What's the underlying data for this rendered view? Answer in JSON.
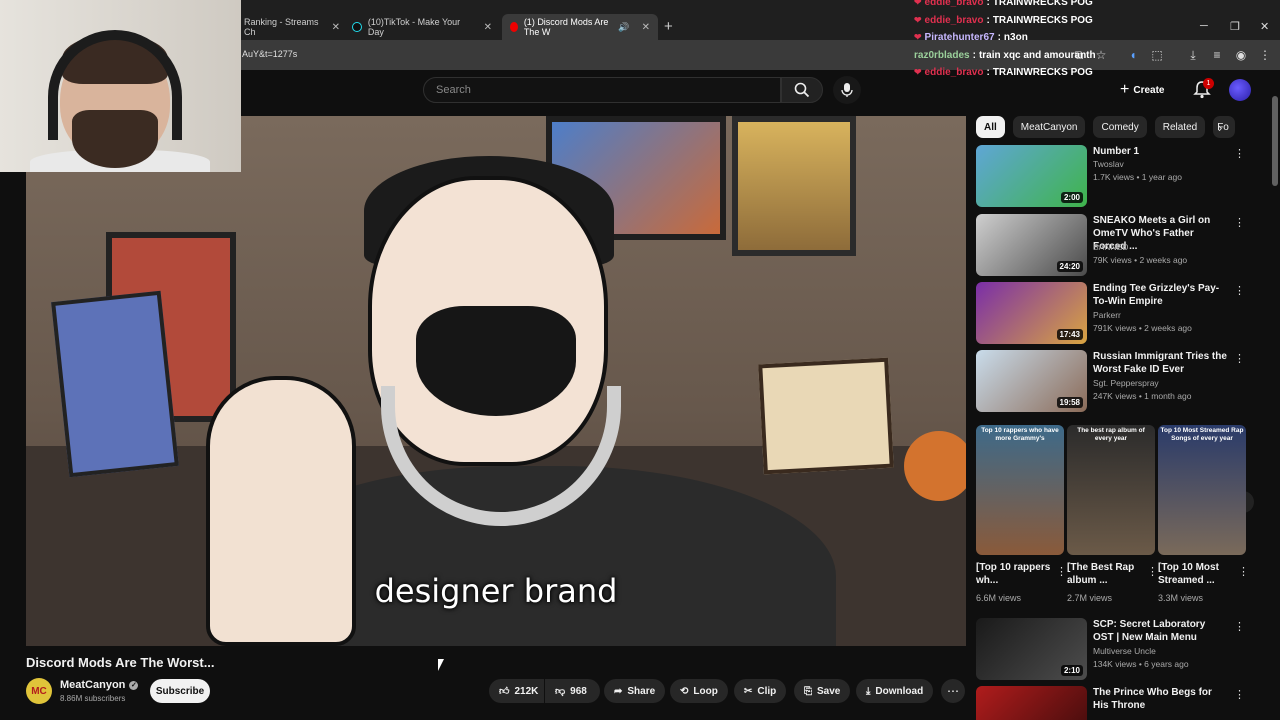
{
  "browser": {
    "tabs": [
      {
        "label": "Ranking - Streams Ch"
      },
      {
        "label": "(10)TikTok - Make Your Day"
      },
      {
        "label": "(1) Discord Mods Are The W"
      }
    ],
    "url": "AuY&t=1277s"
  },
  "masthead": {
    "search_placeholder": "Search",
    "create_label": "Create",
    "notification_count": "1"
  },
  "chat": [
    {
      "user": "eddie_bravo",
      "msg": "TRAINWRECKS POG",
      "color": "#e0304f",
      "heart": true
    },
    {
      "user": "eddie_bravo",
      "msg": "TRAINWRECKS POG",
      "color": "#e0304f",
      "heart": true
    },
    {
      "user": "Piratehunter67",
      "msg": "n3on",
      "color": "#c7b8ff",
      "heart": true
    },
    {
      "user": "raz0rblades",
      "msg": "train xqc and amouranth",
      "color": "#9bd09b",
      "heart": false
    },
    {
      "user": "eddie_bravo",
      "msg": "TRAINWRECKS POG",
      "color": "#e0304f",
      "heart": true
    }
  ],
  "video": {
    "subtitle": "designer brand",
    "title": "Discord Mods Are The Worst...",
    "channel": "MeatCanyon",
    "channel_avatar_text": "MC",
    "subscribers": "8.86M subscribers",
    "subscribe_label": "Subscribe",
    "likes": "212K",
    "dislikes": "968",
    "share_label": "Share",
    "loop_label": "Loop",
    "clip_label": "Clip",
    "save_label": "Save",
    "download_label": "Download"
  },
  "chips": [
    "All",
    "MeatCanyon",
    "Comedy",
    "Related",
    "Fo"
  ],
  "recommendations": [
    {
      "title": "Number 1",
      "channel": "Twoslav",
      "meta": "1.7K views • 1 year ago",
      "duration": "2:00",
      "colors": [
        "#5fa6d6",
        "#3fb44b"
      ]
    },
    {
      "title": "SNEAKO Meets a Girl on OmeTV Who's Father Forced ...",
      "channel": "BANNED",
      "meta": "79K views • 2 weeks ago",
      "duration": "24:20",
      "colors": [
        "#cfcfcf",
        "#4a4a4a"
      ]
    },
    {
      "title": "Ending Tee Grizzley's Pay-To-Win Empire",
      "channel": "Parkerr",
      "meta": "791K views • 2 weeks ago",
      "duration": "17:43",
      "colors": [
        "#7a2ea8",
        "#d9a441"
      ]
    },
    {
      "title": "Russian Immigrant Tries the Worst Fake ID Ever",
      "channel": "Sgt. Pepperspray",
      "meta": "247K views • 1 month ago",
      "duration": "19:58",
      "colors": [
        "#c9dceb",
        "#8b6b58"
      ]
    },
    {
      "title": "SCP: Secret Laboratory OST | New Main Menu",
      "channel": "Multiverse Uncle",
      "meta": "134K views • 6 years ago",
      "duration": "2:10",
      "colors": [
        "#1a1a1a",
        "#4d4d4d"
      ]
    },
    {
      "title": "The Prince Who Begs for His Throne",
      "channel": "",
      "meta": "",
      "duration": "",
      "colors": [
        "#b01c1c",
        "#3a0b0b"
      ]
    }
  ],
  "shorts": [
    {
      "caption": "Top 10 rappers who have more Grammy's",
      "title": "[Top 10 rappers wh...",
      "views": "6.6M views",
      "colors": [
        "#3d6a8a",
        "#8a5a3a"
      ]
    },
    {
      "caption": "The best rap album of every year",
      "title": "[The Best Rap album ...",
      "views": "2.7M views",
      "colors": [
        "#2b2b2b",
        "#6b5a48"
      ]
    },
    {
      "caption": "Top 10 Most Streamed Rap Songs of every year",
      "title": "[Top 10 Most Streamed ...",
      "views": "3.3M views",
      "colors": [
        "#2a3b6a",
        "#7a6a5a"
      ]
    }
  ]
}
